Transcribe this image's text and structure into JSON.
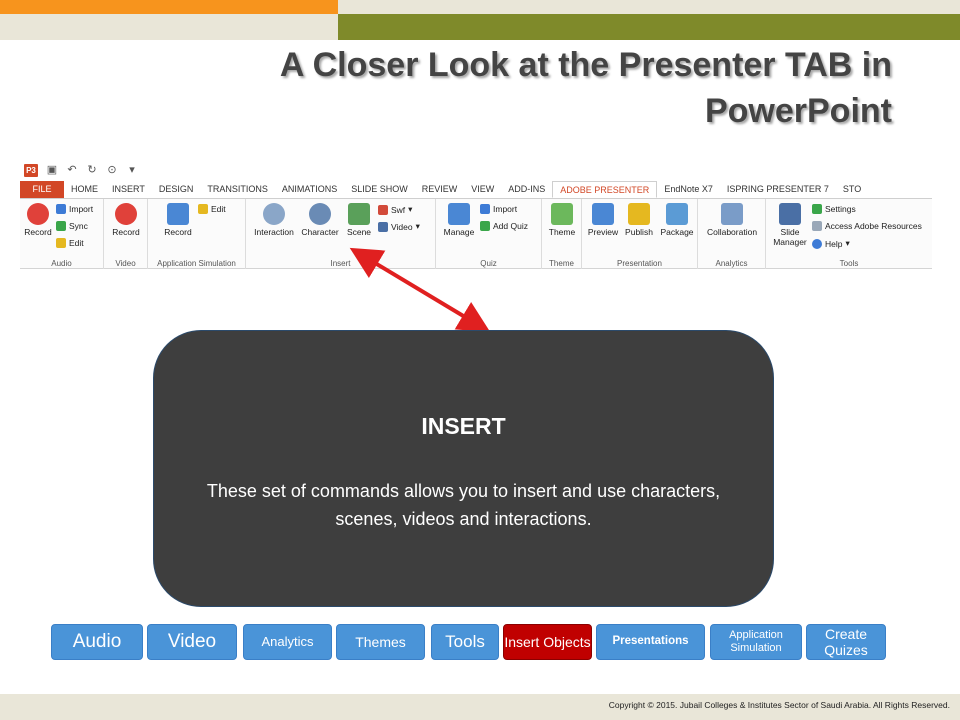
{
  "slide": {
    "title": "A Closer Look at the Presenter TAB in PowerPoint",
    "copyright": "Copyright © 2015. Jubail Colleges & Institutes Sector of Saudi Arabia. All Rights Reserved."
  },
  "ribbon": {
    "app_badge": "P3",
    "tabs": [
      "FILE",
      "HOME",
      "INSERT",
      "DESIGN",
      "TRANSITIONS",
      "ANIMATIONS",
      "SLIDE SHOW",
      "REVIEW",
      "VIEW",
      "ADD-INS",
      "ADOBE PRESENTER",
      "EndNote X7",
      "ISPRING PRESENTER 7",
      "STO"
    ],
    "active_tab": "ADOBE PRESENTER",
    "groups": {
      "audio": {
        "label": "Audio",
        "record": "Record",
        "import": "Import",
        "sync": "Sync",
        "edit": "Edit"
      },
      "video": {
        "label": "Video",
        "record": "Record"
      },
      "appsim": {
        "label": "Application Simulation",
        "record": "Record",
        "edit": "Edit"
      },
      "insert": {
        "label": "Insert",
        "interaction": "Interaction",
        "character": "Character",
        "scene": "Scene",
        "swf": "Swf",
        "video": "Video"
      },
      "quiz": {
        "label": "Quiz",
        "manage": "Manage",
        "import": "Import",
        "add_quiz": "Add Quiz"
      },
      "theme": {
        "label": "Theme",
        "theme": "Theme"
      },
      "presentation": {
        "label": "Presentation",
        "preview": "Preview",
        "publish": "Publish",
        "package": "Package"
      },
      "analytics": {
        "label": "Analytics",
        "collaboration": "Collaboration"
      },
      "tools": {
        "label": "Tools",
        "slide_manager": "Slide Manager",
        "settings": "Settings",
        "access": "Access Adobe Resources",
        "help": "Help"
      }
    }
  },
  "callout": {
    "title": "INSERT",
    "body": "These set of commands allows you to insert and use characters, scenes, videos and interactions."
  },
  "nav": {
    "audio": "Audio",
    "video": "Video",
    "analytics": "Analytics",
    "themes": "Themes",
    "tools": "Tools",
    "insert_objects": "Insert Objects",
    "presentations": "Presentations",
    "application_simulation": "Application Simulation",
    "create_quizes": "Create Quizes"
  },
  "colors": {
    "orange_bar": "#f7941d",
    "olive_bar": "#7f8a2a",
    "nav_blue": "#4a94d8",
    "nav_active": "#c00000",
    "callout_bg": "#3e3e3e",
    "arrow": "#e02020"
  }
}
